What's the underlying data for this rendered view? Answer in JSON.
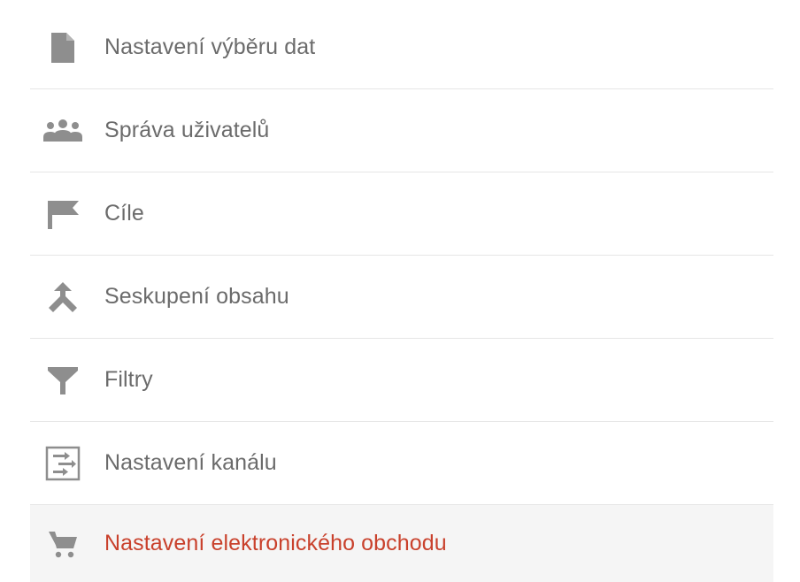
{
  "menu": {
    "items": [
      {
        "label": "Nastavení výběru dat",
        "icon": "document-icon",
        "active": false
      },
      {
        "label": "Správa uživatelů",
        "icon": "people-icon",
        "active": false
      },
      {
        "label": "Cíle",
        "icon": "flag-icon",
        "active": false
      },
      {
        "label": "Seskupení obsahu",
        "icon": "merge-icon",
        "active": false
      },
      {
        "label": "Filtry",
        "icon": "filter-icon",
        "active": false
      },
      {
        "label": "Nastavení kanálu",
        "icon": "channel-settings-icon",
        "active": false
      },
      {
        "label": "Nastavení elektronického obchodu",
        "icon": "cart-icon",
        "active": true
      }
    ]
  },
  "colors": {
    "icon": "#8e8e8e",
    "label": "#6b6b6b",
    "active_label": "#c9412c",
    "active_background": "#f5f5f5",
    "divider": "#e6e6e6"
  }
}
